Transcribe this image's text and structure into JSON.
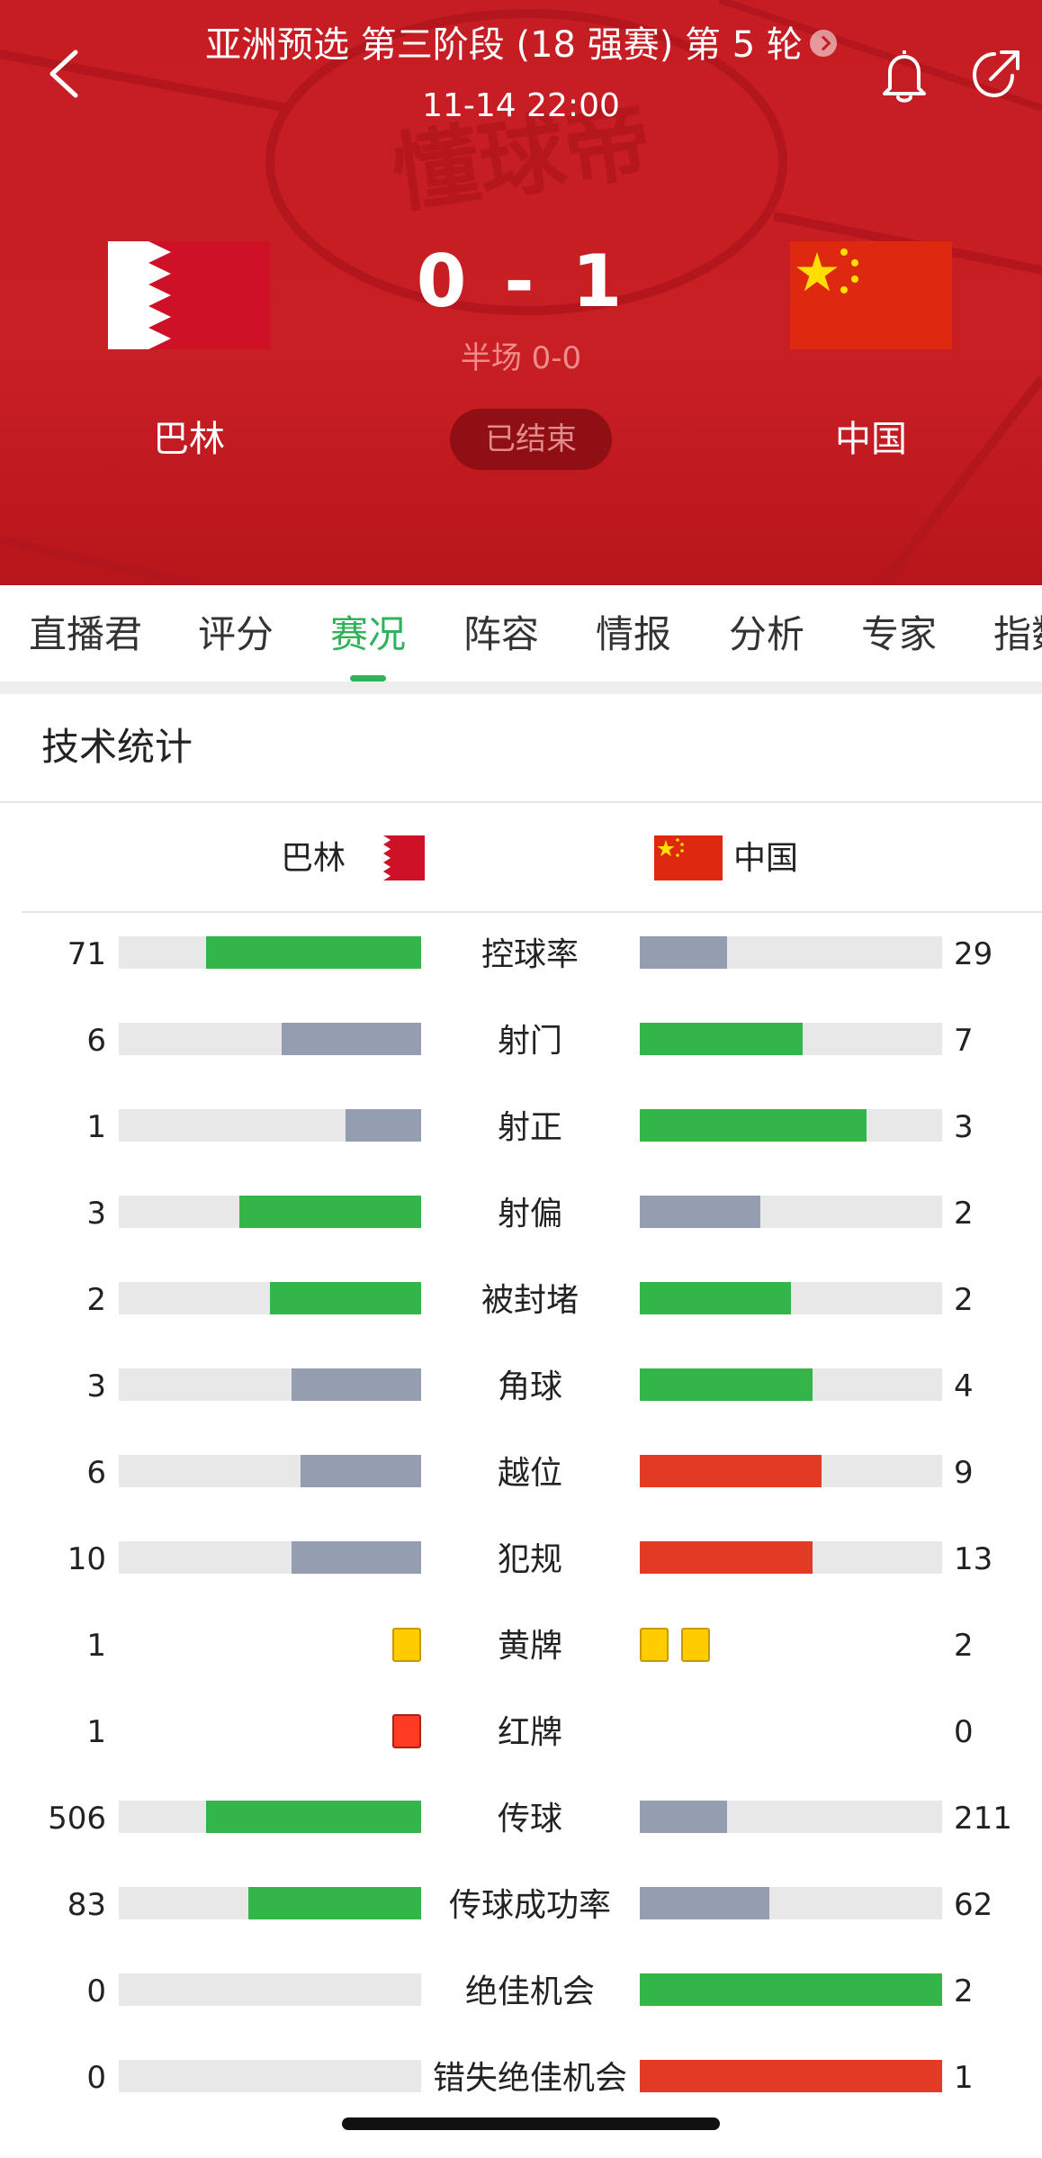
{
  "header": {
    "title": "亚洲预选 第三阶段 (18 强赛) 第 5 轮",
    "datetime": "11-14 22:00",
    "home": {
      "name": "巴林",
      "score": "0"
    },
    "away": {
      "name": "中国",
      "score": "1"
    },
    "score_separator": "-",
    "halftime": "半场 0-0",
    "status": "已结束",
    "watermark": "懂球帝",
    "icons": [
      "back-icon",
      "bell-icon",
      "share-icon"
    ]
  },
  "tabs": [
    "直播君",
    "评分",
    "赛况",
    "阵容",
    "情报",
    "分析",
    "专家",
    "指数"
  ],
  "active_tab": "赛况",
  "stats": {
    "title": "技术统计",
    "home_team": "巴林",
    "away_team": "中国",
    "rows": [
      {
        "label": "控球率",
        "home": "71",
        "away": "29",
        "home_ratio": 0.71,
        "away_ratio": 0.29,
        "home_color": "green",
        "away_color": "gray"
      },
      {
        "label": "射门",
        "home": "6",
        "away": "7",
        "home_ratio": 0.46,
        "away_ratio": 0.54,
        "home_color": "gray",
        "away_color": "green"
      },
      {
        "label": "射正",
        "home": "1",
        "away": "3",
        "home_ratio": 0.25,
        "away_ratio": 0.75,
        "home_color": "gray",
        "away_color": "green"
      },
      {
        "label": "射偏",
        "home": "3",
        "away": "2",
        "home_ratio": 0.6,
        "away_ratio": 0.4,
        "home_color": "green",
        "away_color": "gray"
      },
      {
        "label": "被封堵",
        "home": "2",
        "away": "2",
        "home_ratio": 0.5,
        "away_ratio": 0.5,
        "home_color": "green",
        "away_color": "green"
      },
      {
        "label": "角球",
        "home": "3",
        "away": "4",
        "home_ratio": 0.43,
        "away_ratio": 0.57,
        "home_color": "gray",
        "away_color": "green"
      },
      {
        "label": "越位",
        "home": "6",
        "away": "9",
        "home_ratio": 0.4,
        "away_ratio": 0.6,
        "home_color": "gray",
        "away_color": "red"
      },
      {
        "label": "犯规",
        "home": "10",
        "away": "13",
        "home_ratio": 0.43,
        "away_ratio": 0.57,
        "home_color": "gray",
        "away_color": "red"
      },
      {
        "label": "黄牌",
        "home": "1",
        "away": "2",
        "type": "yellow-card",
        "home_cards": 1,
        "away_cards": 2
      },
      {
        "label": "红牌",
        "home": "1",
        "away": "0",
        "type": "red-card",
        "home_cards": 1,
        "away_cards": 0
      },
      {
        "label": "传球",
        "home": "506",
        "away": "211",
        "home_ratio": 0.71,
        "away_ratio": 0.29,
        "home_color": "green",
        "away_color": "gray"
      },
      {
        "label": "传球成功率",
        "home": "83",
        "away": "62",
        "home_ratio": 0.57,
        "away_ratio": 0.43,
        "home_color": "green",
        "away_color": "gray"
      },
      {
        "label": "绝佳机会",
        "home": "0",
        "away": "2",
        "home_ratio": 0.0,
        "away_ratio": 1.0,
        "home_color": "gray",
        "away_color": "green"
      },
      {
        "label": "错失绝佳机会",
        "home": "0",
        "away": "1",
        "home_ratio": 0.0,
        "away_ratio": 1.0,
        "home_color": "gray",
        "away_color": "red"
      }
    ]
  },
  "colors": {
    "header_red": "#c51d23",
    "accent_green": "#2fb35a",
    "bar_green": "#33b54a",
    "bar_gray": "#959eb0",
    "bar_red": "#e23a24",
    "track": "#e8e8e8"
  }
}
